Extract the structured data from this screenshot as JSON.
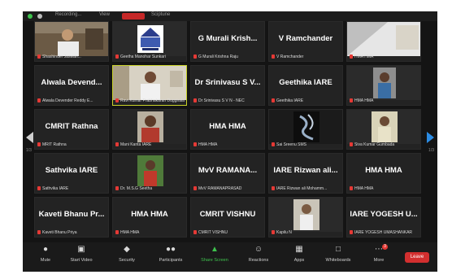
{
  "window": {
    "top_labels": [
      "Recording...",
      "View",
      "Sciptune"
    ]
  },
  "pager": {
    "left_indicator": "1/3",
    "right_indicator": "1/3"
  },
  "tiles": [
    {
      "big": "",
      "caption": "Shashinder Jaswan..."
    },
    {
      "big": "",
      "caption": "Geetha Manohar Sunkari"
    },
    {
      "big": "G Murali  Krish...",
      "caption": "G Murali  Krishna Raju"
    },
    {
      "big": "V Ramchander",
      "caption": "V Ramchander"
    },
    {
      "big": "",
      "caption": "HMA HMA"
    },
    {
      "big": "Alwala  Devend...",
      "caption": "Alwala Devender Reddy E..."
    },
    {
      "big": "",
      "caption": "Ravi Kumar Prabhakaran Duggirala"
    },
    {
      "big": "Dr Srinivasu S V...",
      "caption": "Dr Srinivasu S V N - NEC"
    },
    {
      "big": "Geethika IARE",
      "caption": "Geethika IARE"
    },
    {
      "big": "",
      "caption": "HMA HMA"
    },
    {
      "big": "CMRIT Rathna",
      "caption": "MRIT Rathna"
    },
    {
      "big": "",
      "caption": "Mani Kanta IARE"
    },
    {
      "big": "HMA HMA",
      "caption": "HMA HMA"
    },
    {
      "big": "",
      "caption": "Sai Sreenu SMS"
    },
    {
      "big": "",
      "caption": "Siva Kumar Gumbada"
    },
    {
      "big": "Sathvika IARE",
      "caption": "Sathvika IARE"
    },
    {
      "big": "",
      "caption": "Dr. M.S.G Seetha"
    },
    {
      "big": "MvV  RAMANA...",
      "caption": "MvV RAMANAPRASAD"
    },
    {
      "big": "IARE  Rizwan  ali...",
      "caption": "IARE Rizwan ali Mohamm..."
    },
    {
      "big": "HMA HMA",
      "caption": "HMA HMA"
    },
    {
      "big": "Kaveti  Bhanu  Pr...",
      "caption": "Kaveti Bhanu Priya"
    },
    {
      "big": "HMA HMA",
      "caption": "HMA HMA"
    },
    {
      "big": "CMRIT VISHNU",
      "caption": "CMRIT VISHNU"
    },
    {
      "big": "",
      "caption": "Kapilu N"
    },
    {
      "big": "IARE  YOGESH  U...",
      "caption": "IARE YOGESH UMASHANKAR"
    }
  ],
  "toolbar": {
    "mute": "Mute",
    "start_video": "Start Video",
    "security": "Security",
    "participants": "Participants",
    "participants_count": "25",
    "share_screen": "Share Screen",
    "reactions": "Reactions",
    "apps": "Apps",
    "whiteboards": "Whiteboards",
    "more": "More",
    "more_badge": "3",
    "leave": "Leave"
  },
  "colors": {
    "active_speaker_border": "#c9d22a",
    "leave": "#d32f2f",
    "share": "#3ec24d",
    "next_arrow": "#2b8be3"
  }
}
